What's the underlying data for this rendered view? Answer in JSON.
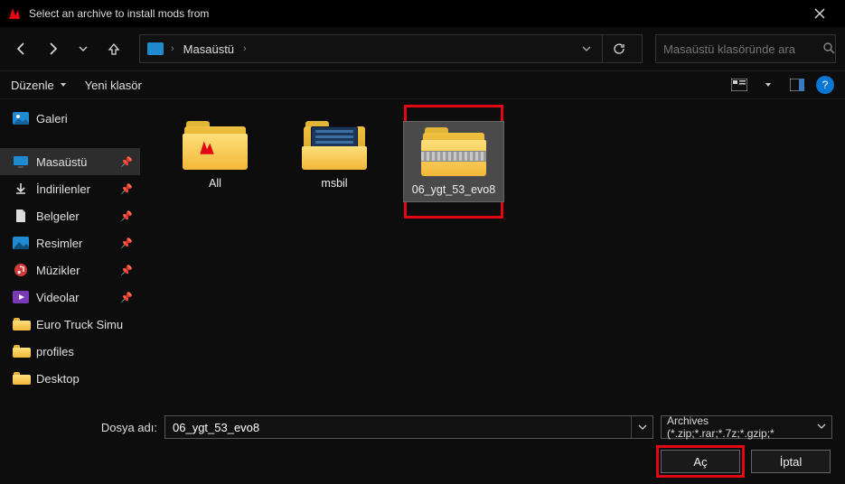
{
  "window": {
    "title": "Select an archive to install mods from"
  },
  "address": {
    "root_icon": "pc",
    "segments": [
      "Masaüstü"
    ],
    "search_placeholder": "Masaüstü klasöründe ara"
  },
  "toolbar": {
    "organize": "Düzenle",
    "new_folder": "Yeni klasör",
    "help": "?"
  },
  "sidebar": {
    "items": [
      {
        "icon": "gallery",
        "label": "Galeri",
        "pinned": false,
        "active": false
      },
      {
        "spacer": true
      },
      {
        "icon": "desktop",
        "label": "Masaüstü",
        "pinned": true,
        "active": true
      },
      {
        "icon": "download",
        "label": "İndirilenler",
        "pinned": true,
        "active": false
      },
      {
        "icon": "document",
        "label": "Belgeler",
        "pinned": true,
        "active": false
      },
      {
        "icon": "pictures",
        "label": "Resimler",
        "pinned": true,
        "active": false
      },
      {
        "icon": "music",
        "label": "Müzikler",
        "pinned": true,
        "active": false
      },
      {
        "icon": "videos",
        "label": "Videolar",
        "pinned": true,
        "active": false
      },
      {
        "icon": "folder",
        "label": "Euro Truck Simu",
        "pinned": false,
        "active": false
      },
      {
        "icon": "folder",
        "label": "profiles",
        "pinned": false,
        "active": false
      },
      {
        "icon": "folder",
        "label": "Desktop",
        "pinned": false,
        "active": false
      }
    ]
  },
  "files": [
    {
      "name": "All",
      "type": "folder-app",
      "selected": false
    },
    {
      "name": "msbil",
      "type": "folder-doc",
      "selected": false
    },
    {
      "name": "06_ygt_53_evo8",
      "type": "zip",
      "selected": true,
      "highlighted": true
    }
  ],
  "footer": {
    "filename_label": "Dosya adı:",
    "filename_value": "06_ygt_53_evo8",
    "filter_label": "Archives (*.zip;*.rar;*.7z;*.gzip;*",
    "open": "Aç",
    "cancel": "İptal"
  }
}
